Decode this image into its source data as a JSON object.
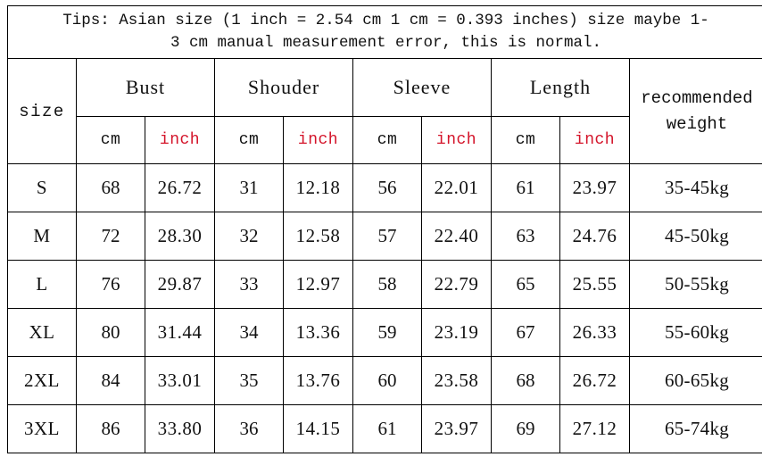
{
  "tips": {
    "line1": "Tips: Asian size (1 inch = 2.54 cm 1 cm = 0.393 inches) size maybe 1-",
    "line2": "3 cm manual measurement error, this is normal.",
    "color": "#1a1ab4"
  },
  "colors": {
    "inch_red": "#d4142a",
    "text_black": "#111111",
    "border": "#000000",
    "background": "#ffffff"
  },
  "table": {
    "size_header": "size",
    "groups": [
      "Bust",
      "Shouder",
      "Sleeve",
      "Length"
    ],
    "units": [
      "cm",
      "inch",
      "cm",
      "inch",
      "cm",
      "inch",
      "cm",
      "inch"
    ],
    "unit_cm_label": "cm",
    "unit_inch_label": "inch",
    "weight_header_line1": "recommended",
    "weight_header_line2": "weight",
    "rows": [
      {
        "size": "S",
        "bust_cm": "68",
        "bust_inch": "26.72",
        "shoulder_cm": "31",
        "shoulder_inch": "12.18",
        "sleeve_cm": "56",
        "sleeve_inch": "22.01",
        "length_cm": "61",
        "length_inch": "23.97",
        "weight": "35-45kg"
      },
      {
        "size": "M",
        "bust_cm": "72",
        "bust_inch": "28.30",
        "shoulder_cm": "32",
        "shoulder_inch": "12.58",
        "sleeve_cm": "57",
        "sleeve_inch": "22.40",
        "length_cm": "63",
        "length_inch": "24.76",
        "weight": "45-50kg"
      },
      {
        "size": "L",
        "bust_cm": "76",
        "bust_inch": "29.87",
        "shoulder_cm": "33",
        "shoulder_inch": "12.97",
        "sleeve_cm": "58",
        "sleeve_inch": "22.79",
        "length_cm": "65",
        "length_inch": "25.55",
        "weight": "50-55kg"
      },
      {
        "size": "XL",
        "bust_cm": "80",
        "bust_inch": "31.44",
        "shoulder_cm": "34",
        "shoulder_inch": "13.36",
        "sleeve_cm": "59",
        "sleeve_inch": "23.19",
        "length_cm": "67",
        "length_inch": "26.33",
        "weight": "55-60kg"
      },
      {
        "size": "2XL",
        "bust_cm": "84",
        "bust_inch": "33.01",
        "shoulder_cm": "35",
        "shoulder_inch": "13.76",
        "sleeve_cm": "60",
        "sleeve_inch": "23.58",
        "length_cm": "68",
        "length_inch": "26.72",
        "weight": "60-65kg"
      },
      {
        "size": "3XL",
        "bust_cm": "86",
        "bust_inch": "33.80",
        "shoulder_cm": "36",
        "shoulder_inch": "14.15",
        "sleeve_cm": "61",
        "sleeve_inch": "23.97",
        "length_cm": "69",
        "length_inch": "27.12",
        "weight": "65-74kg"
      }
    ]
  }
}
